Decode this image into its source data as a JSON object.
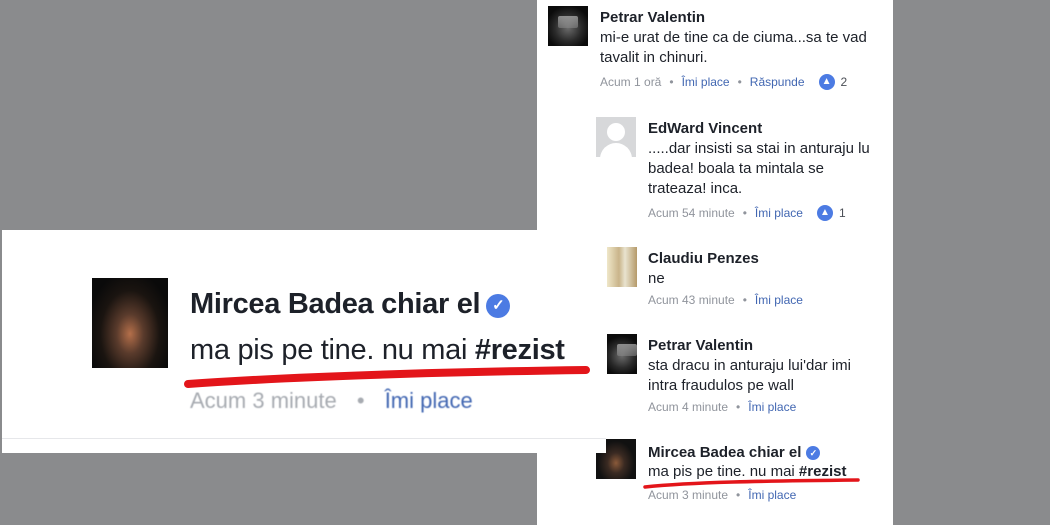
{
  "comments": [
    {
      "author": "Petrar Valentin",
      "text": "mi-e urat de tine ca de ciuma...sa te vad tavalit in chinuri.",
      "time": "Acum 1 oră",
      "like_label": "Îmi place",
      "reply_label": "Răspunde",
      "likes": "2",
      "avatar_icon": "profile-photo"
    },
    {
      "author": "EdWard Vincent",
      "text": ".....dar insisti sa stai in anturaju lu badea! boala ta mintala se trateaza! inca.",
      "time": "Acum 54 minute",
      "like_label": "Îmi place",
      "likes": "1",
      "avatar_icon": "default-avatar"
    },
    {
      "author": "Claudiu Penzes",
      "text": "ne",
      "time": "Acum 43 minute",
      "like_label": "Îmi place",
      "avatar_icon": "profile-photo"
    },
    {
      "author": "Petrar Valentin",
      "text": "sta dracu in anturaju lui'dar imi intra fraudulos pe wall",
      "time": "Acum 4 minute",
      "like_label": "Îmi place",
      "avatar_icon": "profile-photo"
    },
    {
      "author": "Mircea Badea chiar el",
      "text_plain": "ma pis pe tine. nu mai ",
      "hashtag": "#rezist",
      "time": "Acum 3 minute",
      "like_label": "Îmi place",
      "avatar_icon": "gorilla-photo"
    }
  ],
  "inset": {
    "author": "Mircea Badea chiar el",
    "text_plain": "ma pis pe tine. nu mai ",
    "hashtag": "#rezist",
    "time": "Acum 3 minute",
    "like_label": "Îmi place"
  },
  "glyphs": {
    "verified": "✓",
    "like": "👍",
    "dot": "•"
  },
  "colors": {
    "link": "#4267b2",
    "underline": "#e3151a",
    "verified": "#4c7be3"
  }
}
